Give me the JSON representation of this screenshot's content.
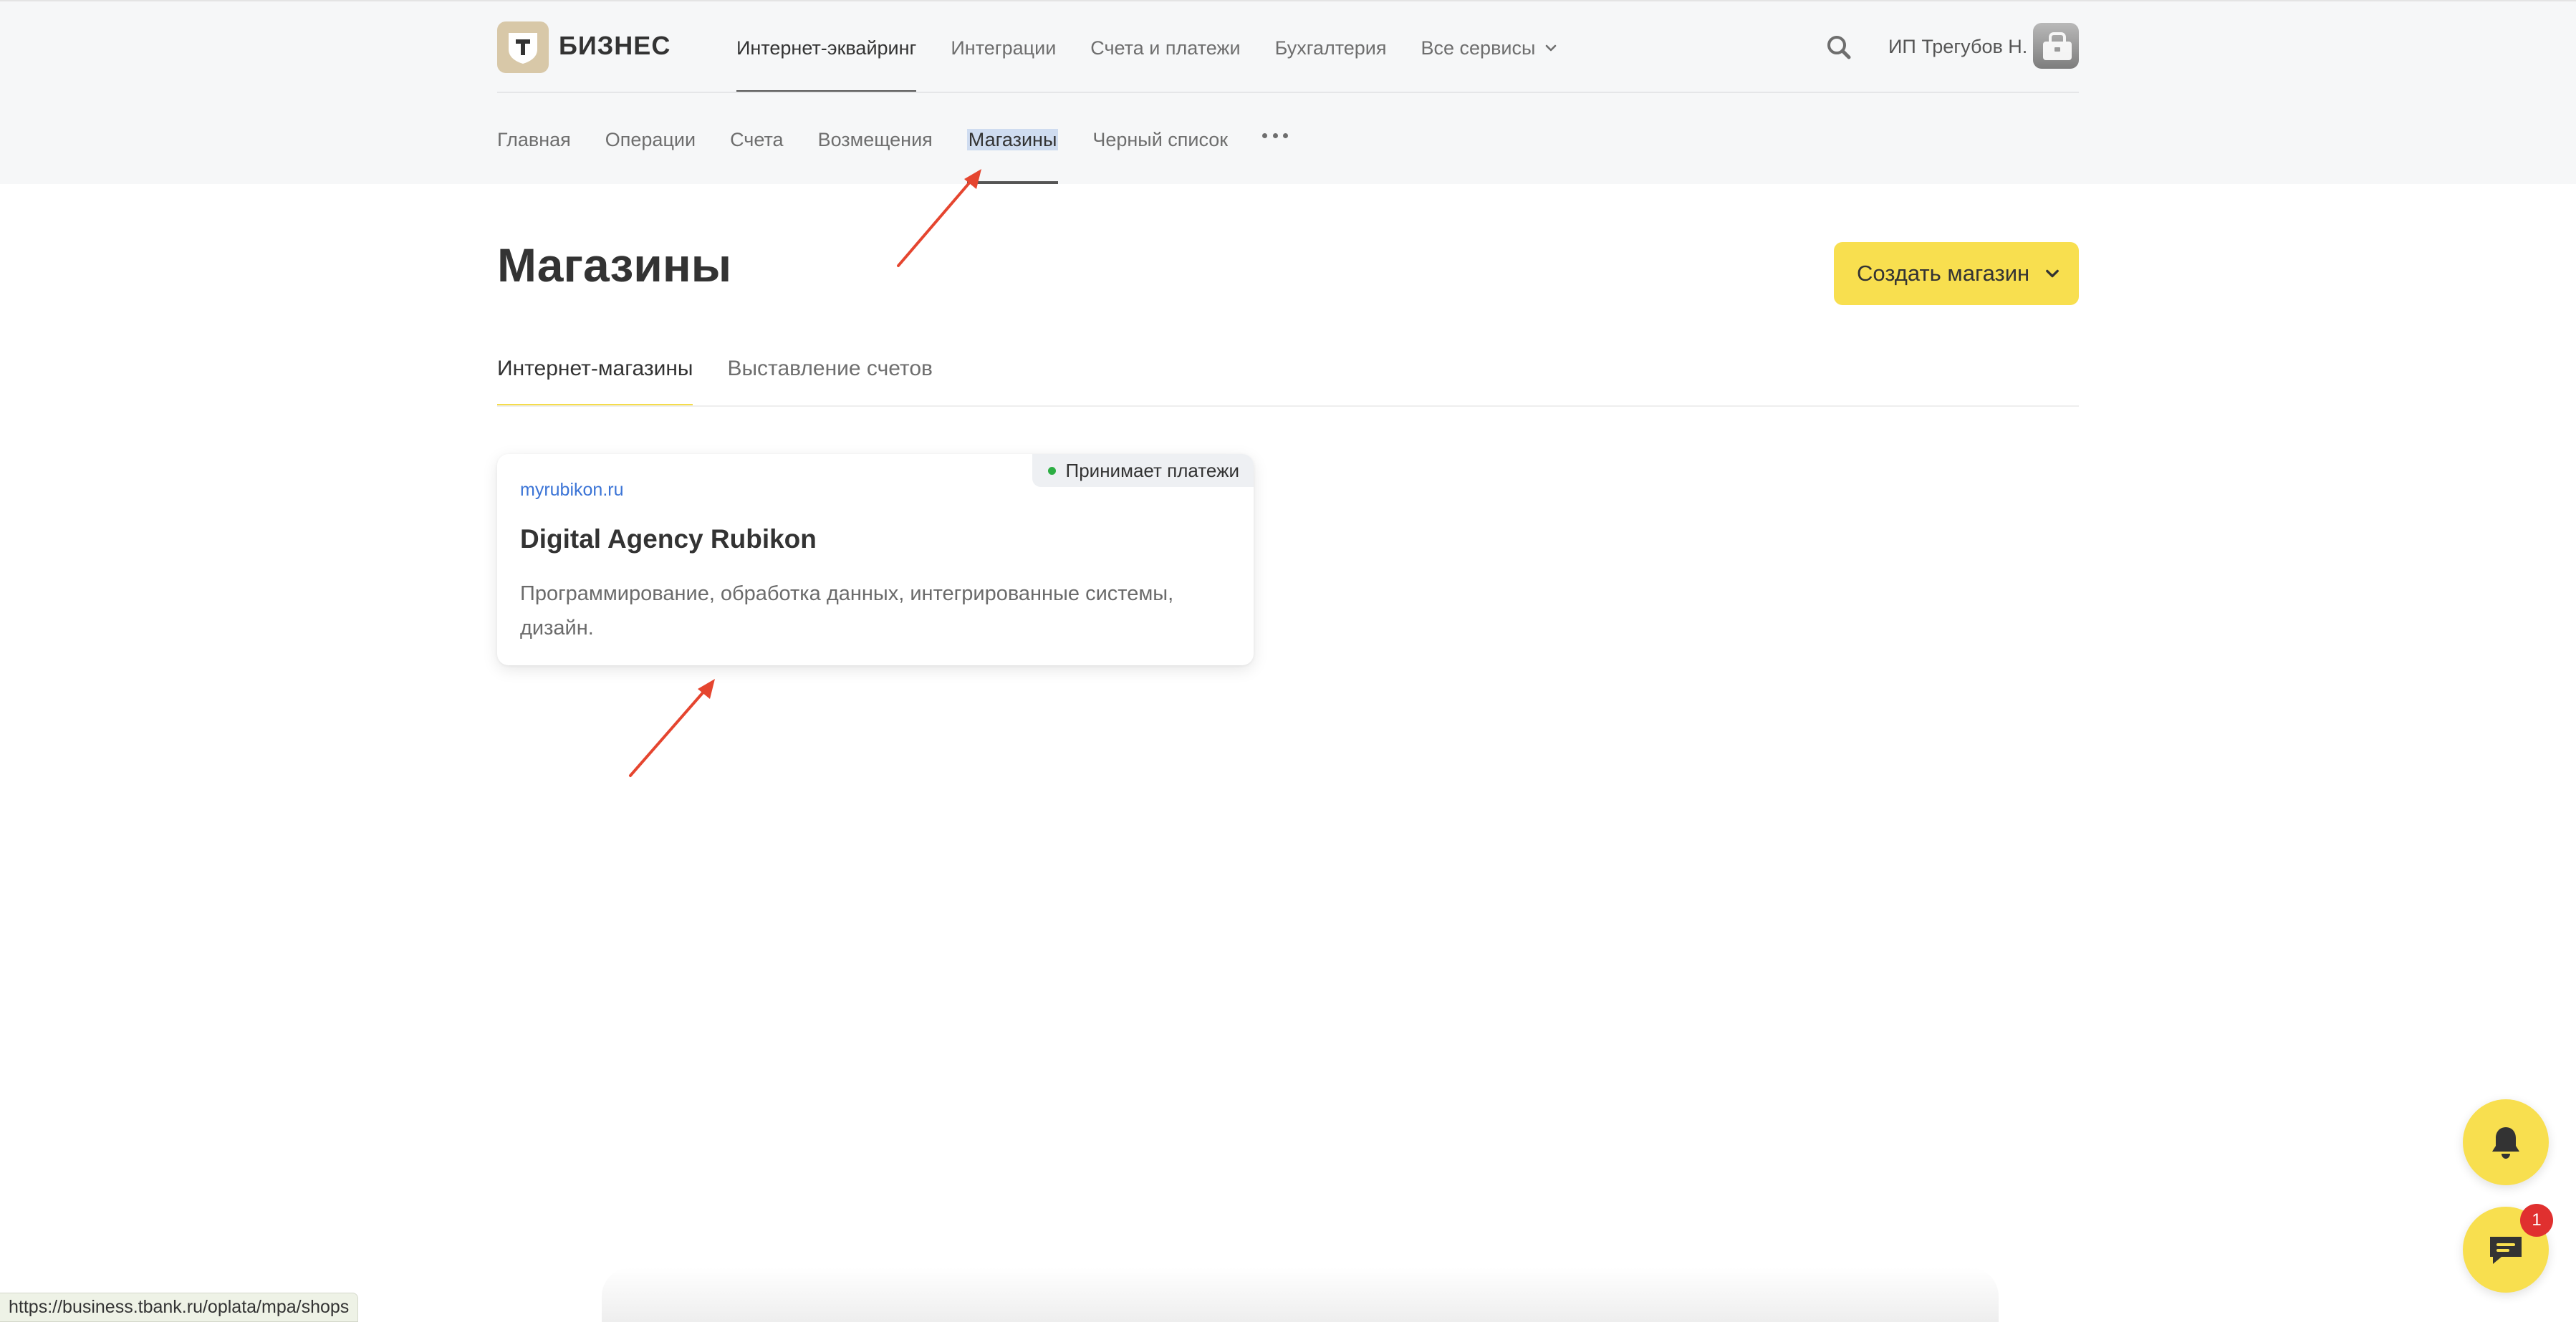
{
  "header": {
    "logo_text": "БИЗНЕС",
    "top_nav": [
      {
        "label": "Интернет-эквайринг",
        "active": true
      },
      {
        "label": "Интеграции",
        "active": false
      },
      {
        "label": "Счета и платежи",
        "active": false
      },
      {
        "label": "Бухгалтерия",
        "active": false
      },
      {
        "label": "Все сервисы",
        "active": false,
        "has_dropdown": true
      }
    ],
    "user_name": "ИП Трегубов Н.",
    "sub_nav": [
      {
        "label": "Главная",
        "active": false
      },
      {
        "label": "Операции",
        "active": false
      },
      {
        "label": "Счета",
        "active": false
      },
      {
        "label": "Возмещения",
        "active": false
      },
      {
        "label": "Магазины",
        "active": true
      },
      {
        "label": "Черный список",
        "active": false
      }
    ]
  },
  "main": {
    "title": "Магазины",
    "create_button_label": "Создать магазин",
    "tabs": [
      {
        "label": "Интернет-магазины",
        "active": true
      },
      {
        "label": "Выставление счетов",
        "active": false
      }
    ],
    "shops": [
      {
        "url": "myrubikon.ru",
        "name": "Digital Agency Rubikon",
        "description": "Программирование, обработка данных, интегрированные системы, дизайн.",
        "status": "Принимает платежи"
      }
    ]
  },
  "floating": {
    "chat_badge_count": "1"
  },
  "status_bar_url": "https://business.tbank.ru/oplata/mpa/shops",
  "colors": {
    "accent_yellow": "#f8df4f",
    "link_blue": "#3b74d6",
    "status_green": "#2cae43",
    "annotation_arrow": "#e5452f",
    "badge_red": "#e0302f"
  }
}
